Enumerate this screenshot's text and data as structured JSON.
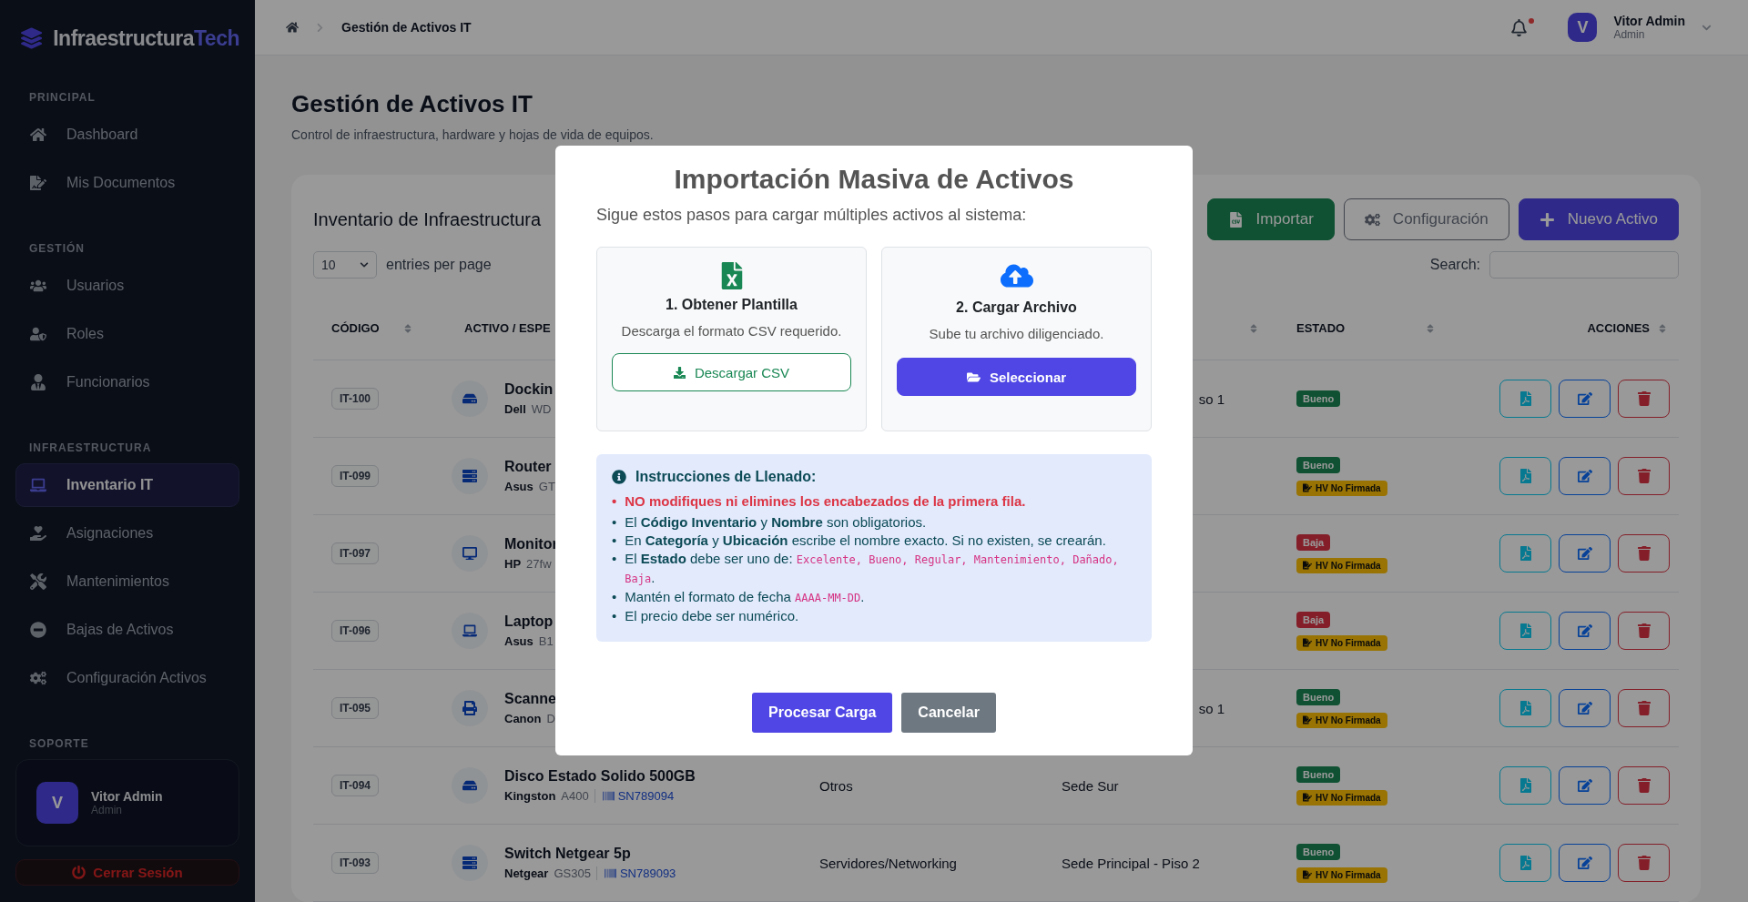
{
  "sidebar": {
    "brand": {
      "name": "Infraestructura",
      "accent": "Tech"
    },
    "sections": [
      {
        "title": "PRINCIPAL",
        "items": [
          {
            "label": "Dashboard",
            "selected": false
          },
          {
            "label": "Mis Documentos",
            "selected": false
          }
        ]
      },
      {
        "title": "GESTIÓN",
        "items": [
          {
            "label": "Usuarios",
            "selected": false
          },
          {
            "label": "Roles",
            "selected": false
          },
          {
            "label": "Funcionarios",
            "selected": false
          }
        ]
      },
      {
        "title": "INFRAESTRUCTURA",
        "items": [
          {
            "label": "Inventario IT",
            "selected": true
          },
          {
            "label": "Asignaciones",
            "selected": false
          },
          {
            "label": "Mantenimientos",
            "selected": false
          },
          {
            "label": "Bajas de Activos",
            "selected": false
          },
          {
            "label": "Configuración Activos",
            "selected": false
          }
        ]
      },
      {
        "title": "SOPORTE"
      }
    ],
    "user": {
      "initial": "V",
      "name": "Vitor Admin",
      "role": "Admin"
    },
    "logout": "Cerrar Sesión"
  },
  "topbar": {
    "breadcrumb": "Gestión de Activos IT",
    "notifications_unread": true,
    "user": {
      "initial": "V",
      "name": "Vitor Admin",
      "role": "Admin"
    }
  },
  "page": {
    "title": "Gestión de Activos IT",
    "subtitle": "Control de infraestructura, hardware y hojas de vida de equipos."
  },
  "card": {
    "title": "Inventario de Infraestructura",
    "buttons": [
      {
        "kind": "import",
        "label": "Importar"
      },
      {
        "kind": "settings",
        "label": "Configuración"
      },
      {
        "kind": "new",
        "label": "Nuevo Activo"
      }
    ],
    "page_size": "10",
    "entries_label": "entries per page",
    "search_label": "Search:"
  },
  "table": {
    "columns": [
      "CÓDIGO",
      "ACTIVO / ESPE",
      "ESTADO",
      "ACCIONES"
    ],
    "rows": [
      {
        "code": "IT-100",
        "kind": "storage",
        "name": "Dockin",
        "brand": "Dell",
        "model": "WD",
        "location": "so 1",
        "location_cut": true,
        "status": {
          "text": "Bueno",
          "kind": "good"
        }
      },
      {
        "code": "IT-099",
        "kind": "network",
        "name": "Router",
        "brand": "Asus",
        "model": "GT",
        "status": {
          "text": "Bueno",
          "kind": "good"
        },
        "hv": "HV No Firmada"
      },
      {
        "code": "IT-097",
        "kind": "monitor",
        "name": "Monitor",
        "brand": "HP",
        "model": "27fw",
        "status": {
          "text": "Baja",
          "kind": "retired"
        },
        "hv": "HV No Firmada"
      },
      {
        "code": "IT-096",
        "kind": "laptop",
        "name": "Laptop",
        "brand": "Asus",
        "model": "B1",
        "status": {
          "text": "Baja",
          "kind": "retired"
        },
        "hv": "HV No Firmada"
      },
      {
        "code": "IT-095",
        "kind": "printer",
        "name": "Scanne",
        "brand": "Canon",
        "model": "D",
        "location": "so 1",
        "location_cut": true,
        "status": {
          "text": "Bueno",
          "kind": "good"
        },
        "hv": "HV No Firmada"
      },
      {
        "code": "IT-094",
        "kind": "storage",
        "name": "Disco Estado Solido 500GB",
        "brand": "Kingston",
        "model": "A400",
        "serial": "SN789094",
        "category": "Otros",
        "location": "Sede Sur",
        "location_cut": false,
        "status": {
          "text": "Bueno",
          "kind": "good"
        },
        "hv": "HV No Firmada"
      },
      {
        "code": "IT-093",
        "kind": "network",
        "name": "Switch Netgear 5p",
        "brand": "Netgear",
        "model": "GS305",
        "serial": "SN789093",
        "category": "Servidores/Networking",
        "location": "Sede Principal - Piso 2",
        "location_cut": false,
        "status": {
          "text": "Bueno",
          "kind": "good"
        },
        "hv": "HV No Firmada"
      }
    ]
  },
  "modal": {
    "title": "Importación Masiva de Activos",
    "subtitle": "Sigue estos pasos para cargar múltiples activos al sistema:",
    "steps": [
      {
        "kind": "download",
        "title": "1. Obtener Plantilla",
        "text": "Descarga el formato CSV requerido.",
        "button": "Descargar CSV"
      },
      {
        "kind": "upload",
        "title": "2. Cargar Archivo",
        "text": "Sube tu archivo diligenciado.",
        "button": "Seleccionar"
      }
    ],
    "instructions": {
      "title": "Instrucciones de Llenado:",
      "items": [
        {
          "kind": "warning",
          "bullet": "•",
          "parts": [
            {
              "kind": "text",
              "text": "NO modifiques ni elimines los encabezados de la primera fila."
            }
          ]
        },
        {
          "kind": "normal",
          "bullet": "•",
          "parts": [
            {
              "kind": "text",
              "text": "El **Código Inventario** y **Nombre** son obligatorios."
            }
          ]
        },
        {
          "kind": "normal",
          "bullet": "•",
          "parts": [
            {
              "kind": "text",
              "text": "En **Categoría** y **Ubicación** escribe el nombre exacto. Si no existen, se crearán."
            }
          ]
        },
        {
          "kind": "normal",
          "bullet": "•",
          "parts": [
            {
              "kind": "text",
              "text": "El **Estado** debe ser uno de: "
            },
            {
              "kind": "code",
              "text": "Excelente, Bueno, Regular, Mantenimiento, Dañado, Baja"
            },
            {
              "kind": "text",
              "text": "."
            }
          ]
        },
        {
          "kind": "normal",
          "bullet": "•",
          "parts": [
            {
              "kind": "text",
              "text": "Mantén el formato de fecha "
            },
            {
              "kind": "code",
              "text": "AAAA-MM-DD"
            },
            {
              "kind": "text",
              "text": "."
            }
          ]
        },
        {
          "kind": "normal",
          "bullet": "•",
          "parts": [
            {
              "kind": "text",
              "text": "El precio debe ser numérico."
            }
          ]
        }
      ]
    },
    "buttons": [
      {
        "kind": "primary",
        "label": "Procesar Carga"
      },
      {
        "kind": "secondary",
        "label": "Cancelar"
      }
    ]
  }
}
